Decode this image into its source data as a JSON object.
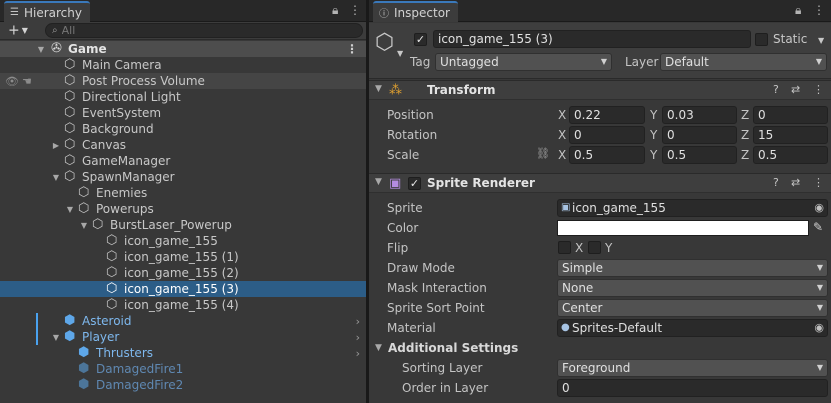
{
  "hierarchy": {
    "tab_title": "Hierarchy",
    "search_placeholder": "All",
    "scene_name": "Game",
    "rows": [
      {
        "label": "Main Camera"
      },
      {
        "label": "Post Process Volume"
      },
      {
        "label": "Directional Light"
      },
      {
        "label": "EventSystem"
      },
      {
        "label": "Background"
      },
      {
        "label": "Canvas"
      },
      {
        "label": "GameManager"
      },
      {
        "label": "SpawnManager"
      },
      {
        "label": "Enemies"
      },
      {
        "label": "Powerups"
      },
      {
        "label": "BurstLaser_Powerup"
      },
      {
        "label": "icon_game_155"
      },
      {
        "label": "icon_game_155 (1)"
      },
      {
        "label": "icon_game_155 (2)"
      },
      {
        "label": "icon_game_155 (3)"
      },
      {
        "label": "icon_game_155 (4)"
      },
      {
        "label": "Asteroid"
      },
      {
        "label": "Player"
      },
      {
        "label": "Thrusters"
      },
      {
        "label": "DamagedFire1"
      },
      {
        "label": "DamagedFire2"
      }
    ],
    "selected": "icon_game_155 (3)"
  },
  "inspector": {
    "tab_title": "Inspector",
    "object_name": "icon_game_155 (3)",
    "active": true,
    "static_label": "Static",
    "tag_label": "Tag",
    "tag_value": "Untagged",
    "layer_label": "Layer",
    "layer_value": "Default",
    "transform": {
      "title": "Transform",
      "position_label": "Position",
      "rotation_label": "Rotation",
      "scale_label": "Scale",
      "axes": [
        "X",
        "Y",
        "Z"
      ],
      "position": [
        "0.22",
        "0.03",
        "0"
      ],
      "rotation": [
        "0",
        "0",
        "15"
      ],
      "scale": [
        "0.5",
        "0.5",
        "0.5"
      ]
    },
    "sprite_renderer": {
      "title": "Sprite Renderer",
      "enabled": true,
      "sprite_label": "Sprite",
      "sprite_value": "icon_game_155",
      "color_label": "Color",
      "color_value": "#ffffff",
      "flip_label": "Flip",
      "flip_x": "X",
      "flip_y": "Y",
      "draw_mode_label": "Draw Mode",
      "draw_mode_value": "Simple",
      "mask_label": "Mask Interaction",
      "mask_value": "None",
      "sort_point_label": "Sprite Sort Point",
      "sort_point_value": "Center",
      "material_label": "Material",
      "material_value": "Sprites-Default",
      "additional_title": "Additional Settings",
      "sorting_layer_label": "Sorting Layer",
      "sorting_layer_value": "Foreground",
      "order_label": "Order in Layer",
      "order_value": "0"
    }
  },
  "colors": {
    "panel_bg": "#383838",
    "selection": "#2c5d87",
    "accent_blue": "#3a79bb",
    "prefab_blue": "#5ea7e9"
  }
}
